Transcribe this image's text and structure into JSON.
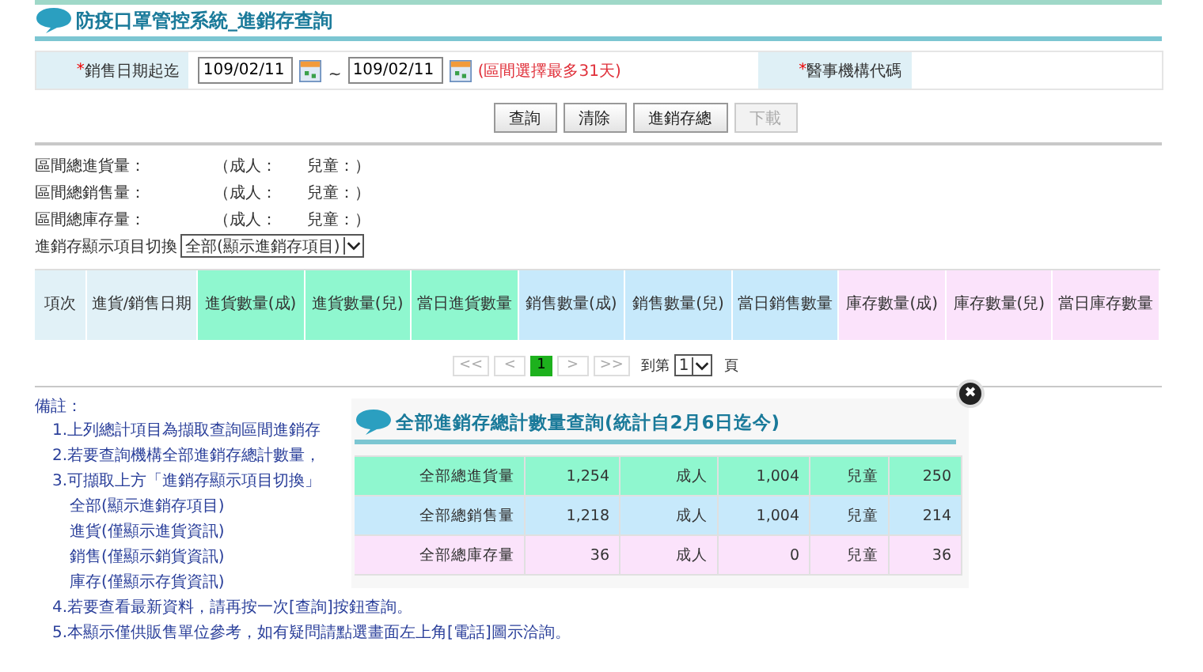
{
  "header": {
    "title": "防疫口罩管控系統_進銷存查詢"
  },
  "form": {
    "date_label": {
      "mark": "*",
      "text": "銷售日期起迄"
    },
    "date_from": "109/02/11",
    "separator": "~",
    "date_to": "109/02/11",
    "hint": "(區間選擇最多31天)",
    "org_label": {
      "mark": "*",
      "text": "醫事機構代碼"
    }
  },
  "buttons": [
    {
      "label": "查詢",
      "disabled": false
    },
    {
      "label": "清除",
      "disabled": false
    },
    {
      "label": "進銷存總",
      "disabled": false
    },
    {
      "label": "下載",
      "disabled": true
    }
  ],
  "summary": [
    {
      "label": "區間總進貨量：",
      "adult": "（成人：",
      "child": "兒童：）"
    },
    {
      "label": "區間總銷售量：",
      "adult": "（成人：",
      "child": "兒童：）"
    },
    {
      "label": "區間總庫存量：",
      "adult": "（成人：",
      "child": "兒童：）"
    }
  ],
  "display_switch": {
    "label": "進銷存顯示項目切換",
    "value": "全部(顯示進銷存項目)"
  },
  "table": {
    "columns": [
      {
        "label": "項次",
        "color": "#e1f1f7"
      },
      {
        "label": "進貨/銷售日期",
        "color": "#e1f1f7"
      },
      {
        "label": "進貨數量(成)",
        "color": "#8ff7cf"
      },
      {
        "label": "進貨數量(兒)",
        "color": "#8ff7cf"
      },
      {
        "label": "當日進貨數量",
        "color": "#8ff7cf"
      },
      {
        "label": "銷售數量(成)",
        "color": "#c7e9fb"
      },
      {
        "label": "銷售數量(兒)",
        "color": "#c7e9fb"
      },
      {
        "label": "當日銷售數量",
        "color": "#c7e9fb"
      },
      {
        "label": "庫存數量(成)",
        "color": "#fbe3fb"
      },
      {
        "label": "庫存數量(兒)",
        "color": "#fbe3fb"
      },
      {
        "label": "當日庫存數量",
        "color": "#fbe3fb"
      }
    ]
  },
  "pagination": {
    "pages": [
      {
        "label": "<<",
        "selected": false
      },
      {
        "label": "<",
        "selected": false
      },
      {
        "label": "1",
        "selected": true
      },
      {
        "label": ">",
        "selected": false
      },
      {
        "label": ">>",
        "selected": false
      }
    ],
    "goto_label": "到第",
    "goto_value": "1",
    "goto_suffix": "頁"
  },
  "notes": {
    "title": "備註：",
    "items": [
      {
        "text": "1.上列總計項目為擷取查詢區間進銷存"
      },
      {
        "text": "2.若要查詢機構全部進銷存總計數量，"
      },
      {
        "text": "3.可擷取上方「進銷存顯示項目切換」",
        "children": [
          {
            "text": "全部(顯示進銷存項目)"
          },
          {
            "text": "進貨(僅顯示進貨資訊)"
          },
          {
            "text": "銷售(僅顯示銷貨資訊)"
          },
          {
            "text": "庫存(僅顯示存貨資訊)"
          }
        ]
      },
      {
        "text": "4.若要查看最新資料，請再按一次[查詢]按鈕查詢。"
      },
      {
        "text": "5.本顯示僅供販售單位參考，如有疑問請點選畫面左上角[電話]圖示洽詢。"
      }
    ]
  },
  "popup": {
    "title": "全部進銷存總計數量查詢(統計自2月6日迄今)",
    "close": "✖",
    "rows": [
      {
        "label": "全部總進貨量",
        "total": "1,254",
        "adult_label": "成人",
        "adult": "1,004",
        "child_label": "兒童",
        "child": "250",
        "color": "#8ff7cf"
      },
      {
        "label": "全部總銷售量",
        "total": "1,218",
        "adult_label": "成人",
        "adult": "1,004",
        "child_label": "兒童",
        "child": "214",
        "color": "#c7e9fb"
      },
      {
        "label": "全部總庫存量",
        "total": "36",
        "adult_label": "成人",
        "adult": "0",
        "child_label": "兒童",
        "child": "36",
        "color": "#fbe3fb"
      }
    ]
  }
}
